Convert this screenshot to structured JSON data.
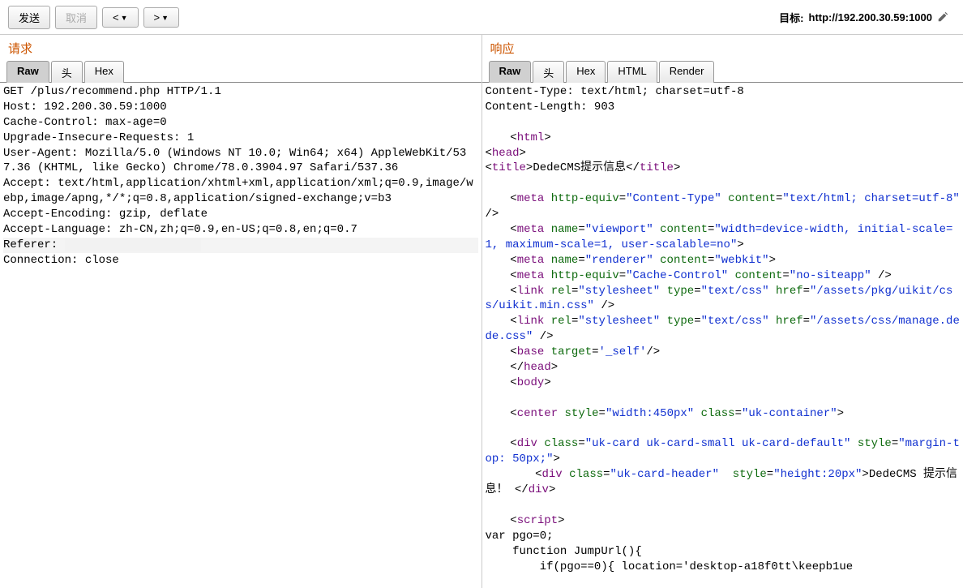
{
  "toolbar": {
    "send": "发送",
    "cancel": "取消",
    "prev": "<",
    "next": ">"
  },
  "target": {
    "label": "目标:",
    "value": "http://192.200.30.59:1000"
  },
  "request": {
    "title": "请求",
    "tabs": {
      "raw": "Raw",
      "headers": "头",
      "hex": "Hex"
    },
    "lines": [
      "GET /plus/recommend.php HTTP/1.1",
      "Host: 192.200.30.59:1000",
      "Cache-Control: max-age=0",
      "Upgrade-Insecure-Requests: 1",
      "User-Agent: Mozilla/5.0 (Windows NT 10.0; Win64; x64) AppleWebKit/537.36 (KHTML, like Gecko) Chrome/78.0.3904.97 Safari/537.36",
      "Accept: text/html,application/xhtml+xml,application/xml;q=0.9,image/webp,image/apng,*/*;q=0.8,application/signed-exchange;v=b3",
      "Accept-Encoding: gzip, deflate",
      "Accept-Language: zh-CN,zh;q=0.9,en-US;q=0.8,en;q=0.7",
      "Referer: ",
      "Connection: close"
    ]
  },
  "response": {
    "title": "响应",
    "tabs": {
      "raw": "Raw",
      "headers": "头",
      "hex": "Hex",
      "html": "HTML",
      "render": "Render"
    },
    "headers": [
      "Content-Type: text/html; charset=utf-8",
      "Content-Length: 903"
    ],
    "body": {
      "title_text": "DedeCMS提示信息",
      "meta_ct_equiv": "Content-Type",
      "meta_ct_content": "text/html; charset=utf-8",
      "meta_vp_name": "viewport",
      "meta_vp_content": "width=device-width, initial-scale=1, maximum-scale=1, user-scalable=no",
      "meta_renderer_name": "renderer",
      "meta_renderer_content": "webkit",
      "meta_cc_equiv": "Cache-Control",
      "meta_cc_content": "no-siteapp",
      "link1_rel": "stylesheet",
      "link1_type": "text/css",
      "link1_href": "/assets/pkg/uikit/css/uikit.min.css",
      "link2_rel": "stylesheet",
      "link2_type": "text/css",
      "link2_href": "/assets/css/manage.dede.css",
      "base_target": "_self",
      "center_style": "width:450px",
      "center_class": "uk-container",
      "div1_class": "uk-card uk-card-small uk-card-default",
      "div1_style": "margin-top: 50px;",
      "div2_class": "uk-card-header",
      "div2_style": "height:20px",
      "div2_text": "DedeCMS 提示信息！",
      "script1": "var pgo=0;",
      "script2": "function JumpUrl(){",
      "script3": "if(pgo==0){ location='desktop-a18f0tt\\keepb1ue"
    }
  }
}
